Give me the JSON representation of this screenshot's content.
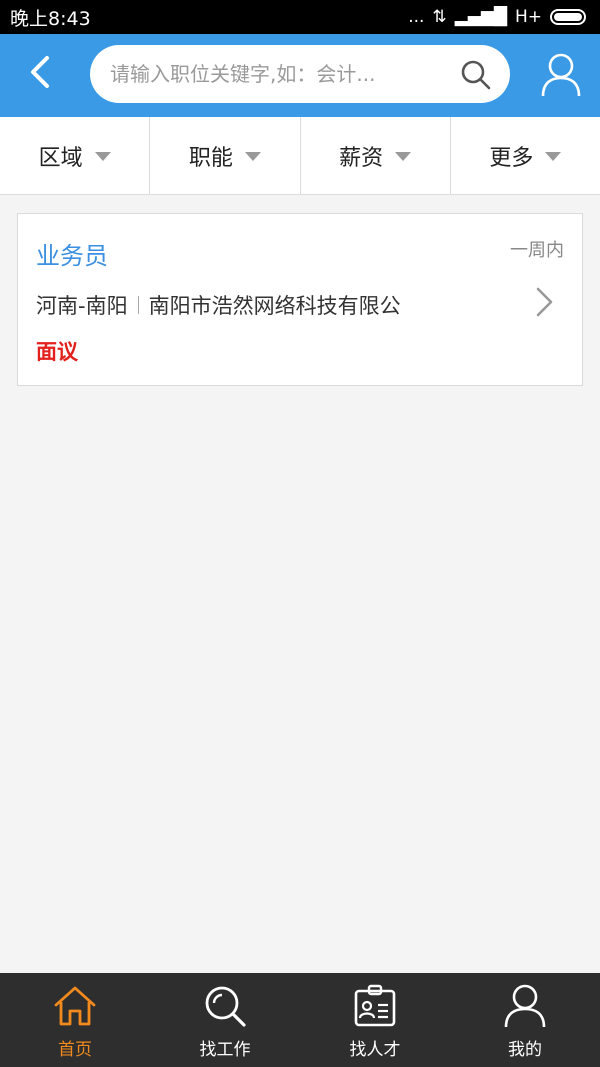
{
  "status": {
    "time": "晚上8:43",
    "signal_text": "... ",
    "network": "H+"
  },
  "header": {
    "search_placeholder": "请输入职位关键字,如：会计..."
  },
  "filters": [
    "区域",
    "职能",
    "薪资",
    "更多"
  ],
  "jobs": [
    {
      "title": "业务员",
      "time": "一周内",
      "location": "河南-南阳",
      "company": "南阳市浩然网络科技有限公",
      "salary": "面议"
    }
  ],
  "tabs": [
    {
      "label": "首页",
      "icon": "home-icon",
      "active": true
    },
    {
      "label": "找工作",
      "icon": "search-icon",
      "active": false
    },
    {
      "label": "找人才",
      "icon": "id-card-icon",
      "active": false
    },
    {
      "label": "我的",
      "icon": "user-icon",
      "active": false
    }
  ],
  "colors": {
    "header": "#3b9ae6",
    "active_tab": "#f28a1d",
    "salary": "#e3201c",
    "job_title": "#3b8fe0"
  }
}
